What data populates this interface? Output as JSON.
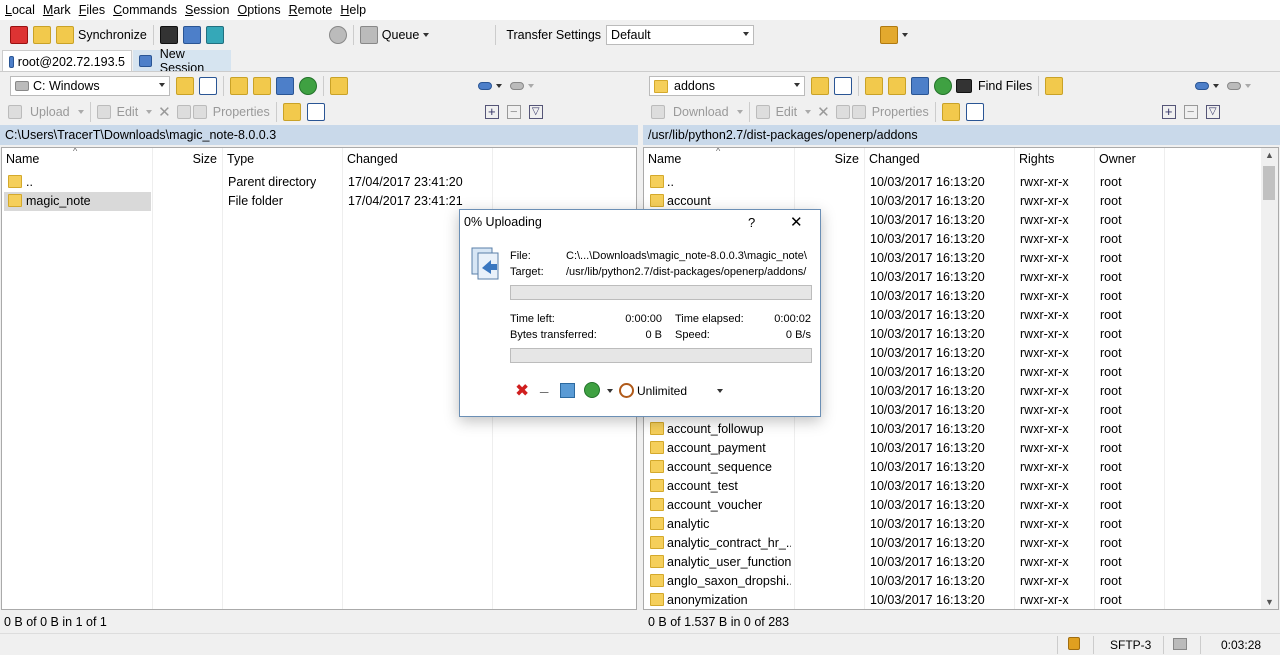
{
  "menu": [
    "Local",
    "Mark",
    "Files",
    "Commands",
    "Session",
    "Options",
    "Remote",
    "Help"
  ],
  "toolbar": {
    "synchronize": "Synchronize",
    "queue": "Queue",
    "transfer_settings_label": "Transfer Settings",
    "transfer_settings_value": "Default"
  },
  "tabs": {
    "session": "root@202.72.193.5",
    "new_session": "New Session"
  },
  "local": {
    "drive": "C: Windows",
    "upload": "Upload",
    "edit": "Edit",
    "properties": "Properties",
    "path": "C:\\Users\\TracerT\\Downloads\\magic_note-8.0.0.3",
    "columns": [
      "Name",
      "Size",
      "Type",
      "Changed"
    ],
    "rows": [
      {
        "name": "..",
        "size": "",
        "type": "Parent directory",
        "changed": "17/04/2017  23:41:20"
      },
      {
        "name": "magic_note",
        "size": "",
        "type": "File folder",
        "changed": "17/04/2017  23:41:21"
      }
    ],
    "status": "0 B of 0 B in 1 of 1"
  },
  "remote": {
    "folder": "addons",
    "find_files": "Find Files",
    "download": "Download",
    "edit": "Edit",
    "properties": "Properties",
    "path": "/usr/lib/python2.7/dist-packages/openerp/addons",
    "columns": [
      "Name",
      "Size",
      "Changed",
      "Rights",
      "Owner"
    ],
    "rows": [
      {
        "name": "..",
        "changed": "10/03/2017 16:13:20",
        "rights": "rwxr-xr-x",
        "owner": "root"
      },
      {
        "name": "account",
        "changed": "10/03/2017 16:13:20",
        "rights": "rwxr-xr-x",
        "owner": "root"
      },
      {
        "name": "",
        "changed": "10/03/2017 16:13:20",
        "rights": "rwxr-xr-x",
        "owner": "root"
      },
      {
        "name": "",
        "changed": "10/03/2017 16:13:20",
        "rights": "rwxr-xr-x",
        "owner": "root"
      },
      {
        "name": "",
        "changed": "10/03/2017 16:13:20",
        "rights": "rwxr-xr-x",
        "owner": "root"
      },
      {
        "name": "",
        "changed": "10/03/2017 16:13:20",
        "rights": "rwxr-xr-x",
        "owner": "root"
      },
      {
        "name": "",
        "changed": "10/03/2017 16:13:20",
        "rights": "rwxr-xr-x",
        "owner": "root"
      },
      {
        "name": "",
        "changed": "10/03/2017 16:13:20",
        "rights": "rwxr-xr-x",
        "owner": "root"
      },
      {
        "name": "",
        "changed": "10/03/2017 16:13:20",
        "rights": "rwxr-xr-x",
        "owner": "root"
      },
      {
        "name": "",
        "changed": "10/03/2017 16:13:20",
        "rights": "rwxr-xr-x",
        "owner": "root"
      },
      {
        "name": "",
        "changed": "10/03/2017 16:13:20",
        "rights": "rwxr-xr-x",
        "owner": "root"
      },
      {
        "name": "",
        "changed": "10/03/2017 16:13:20",
        "rights": "rwxr-xr-x",
        "owner": "root"
      },
      {
        "name": "",
        "changed": "10/03/2017 16:13:20",
        "rights": "rwxr-xr-x",
        "owner": "root"
      },
      {
        "name": "account_followup",
        "changed": "10/03/2017 16:13:20",
        "rights": "rwxr-xr-x",
        "owner": "root"
      },
      {
        "name": "account_payment",
        "changed": "10/03/2017 16:13:20",
        "rights": "rwxr-xr-x",
        "owner": "root"
      },
      {
        "name": "account_sequence",
        "changed": "10/03/2017 16:13:20",
        "rights": "rwxr-xr-x",
        "owner": "root"
      },
      {
        "name": "account_test",
        "changed": "10/03/2017 16:13:20",
        "rights": "rwxr-xr-x",
        "owner": "root"
      },
      {
        "name": "account_voucher",
        "changed": "10/03/2017 16:13:20",
        "rights": "rwxr-xr-x",
        "owner": "root"
      },
      {
        "name": "analytic",
        "changed": "10/03/2017 16:13:20",
        "rights": "rwxr-xr-x",
        "owner": "root"
      },
      {
        "name": "analytic_contract_hr_...",
        "changed": "10/03/2017 16:13:20",
        "rights": "rwxr-xr-x",
        "owner": "root"
      },
      {
        "name": "analytic_user_function",
        "changed": "10/03/2017 16:13:20",
        "rights": "rwxr-xr-x",
        "owner": "root"
      },
      {
        "name": "anglo_saxon_dropshi...",
        "changed": "10/03/2017 16:13:20",
        "rights": "rwxr-xr-x",
        "owner": "root"
      },
      {
        "name": "anonymization",
        "changed": "10/03/2017 16:13:20",
        "rights": "rwxr-xr-x",
        "owner": "root"
      }
    ],
    "status": "0 B of 1.537 B in 0 of 283"
  },
  "statusbar": {
    "protocol": "SFTP-3",
    "time": "0:03:28"
  },
  "dialog": {
    "title": "0% Uploading",
    "help": "?",
    "file_label": "File:",
    "file_value": "C:\\...\\Downloads\\magic_note-8.0.0.3\\magic_note\\",
    "target_label": "Target:",
    "target_value": "/usr/lib/python2.7/dist-packages/openerp/addons/",
    "time_left_label": "Time left:",
    "time_left_value": "0:00:00",
    "time_elapsed_label": "Time elapsed:",
    "time_elapsed_value": "0:00:02",
    "bytes_label": "Bytes transferred:",
    "bytes_value": "0 B",
    "speed_label": "Speed:",
    "speed_value": "0 B/s",
    "speed_limit": "Unlimited",
    "file_progress": 0,
    "total_progress": 0
  }
}
